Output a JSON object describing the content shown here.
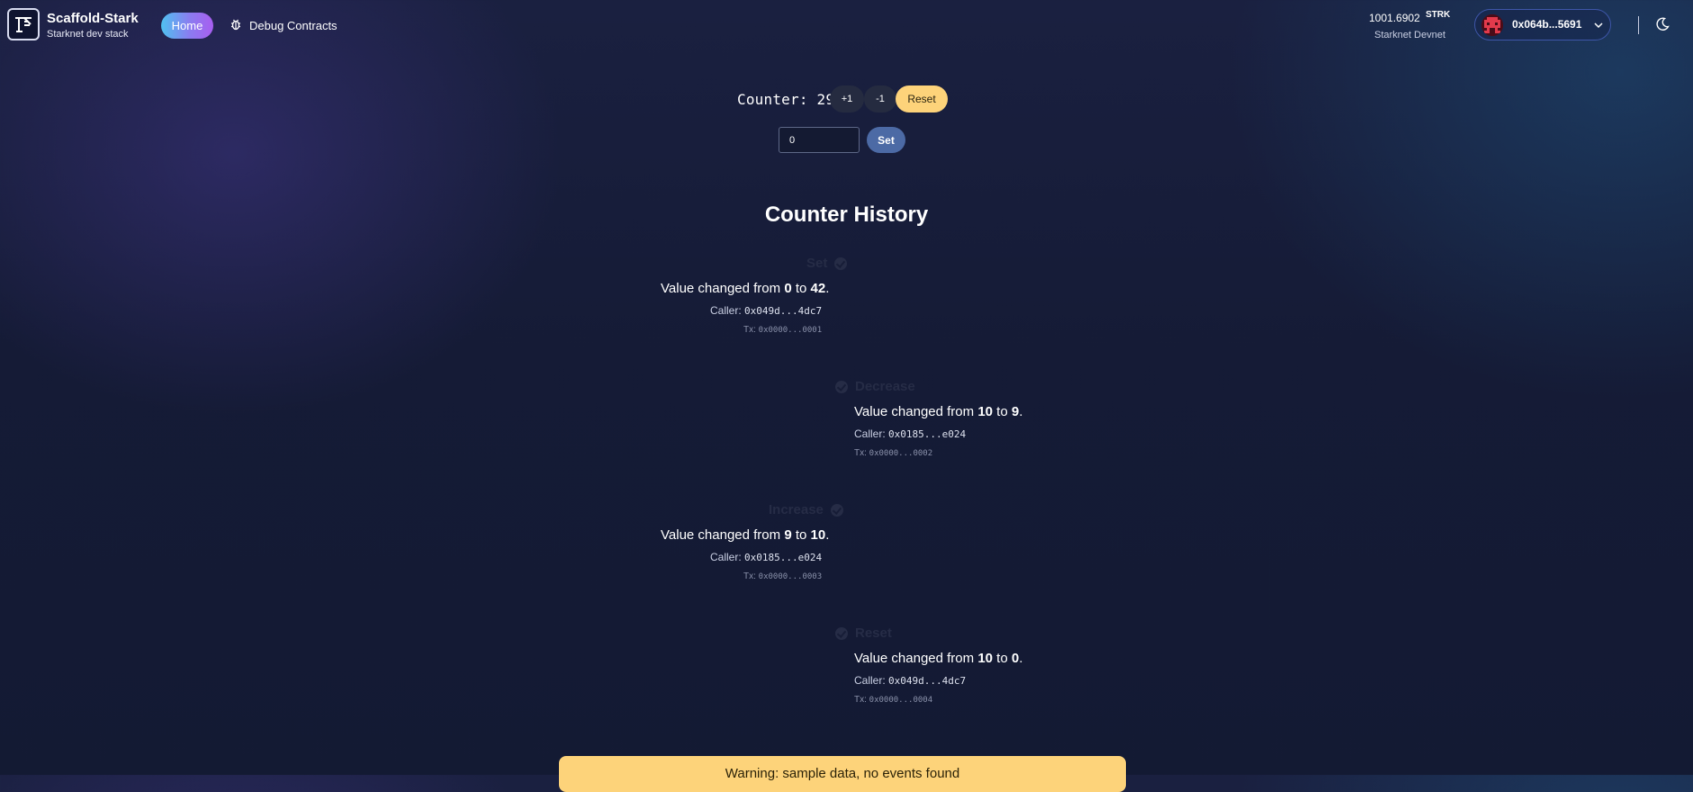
{
  "header": {
    "brand_title": "Scaffold-Stark",
    "brand_subtitle": "Starknet dev stack",
    "nav": {
      "home_label": "Home",
      "debug_label": "Debug Contracts"
    },
    "balance_value": "1001.6902",
    "balance_unit": "STRK",
    "network": "Starknet Devnet",
    "account_address": "0x064b...5691",
    "colors": {
      "home_gradient": [
        "#4fc1f0",
        "#a85ef0"
      ],
      "account_border": "#3e56a8"
    }
  },
  "counter": {
    "label": "Counter: 29",
    "increment_label": "+1",
    "decrement_label": "-1",
    "reset_label": "Reset",
    "set_input_value": "0",
    "set_label": "Set",
    "colors": {
      "reset": "#fdd37a",
      "set": "#4c6aa5"
    }
  },
  "history": {
    "title": "Counter History",
    "events": [
      {
        "type": "Set",
        "from": "0",
        "to": "42",
        "caller": "0x049d...4dc7",
        "tx": "0x0000...0001"
      },
      {
        "type": "Decrease",
        "from": "10",
        "to": "9",
        "caller": "0x0185...e024",
        "tx": "0x0000...0002"
      },
      {
        "type": "Increase",
        "from": "9",
        "to": "10",
        "caller": "0x0185...e024",
        "tx": "0x0000...0003"
      },
      {
        "type": "Reset",
        "from": "10",
        "to": "0",
        "caller": "0x049d...4dc7",
        "tx": "0x0000...0004"
      }
    ],
    "text": {
      "changed_prefix": "Value changed from",
      "changed_mid": "to",
      "end": ".",
      "caller_label": "Caller:",
      "tx_label": "Tx:"
    }
  },
  "warning": {
    "text": "Warning: sample data, no events found",
    "color": "#fdd37a"
  },
  "icons": {
    "logo": "scaffold-logo-icon",
    "debug": "bug-icon",
    "avatar": "pixel-avatar-icon",
    "chevron": "chevron-down-icon",
    "theme": "moon-icon",
    "event": "check-circle-icon"
  }
}
